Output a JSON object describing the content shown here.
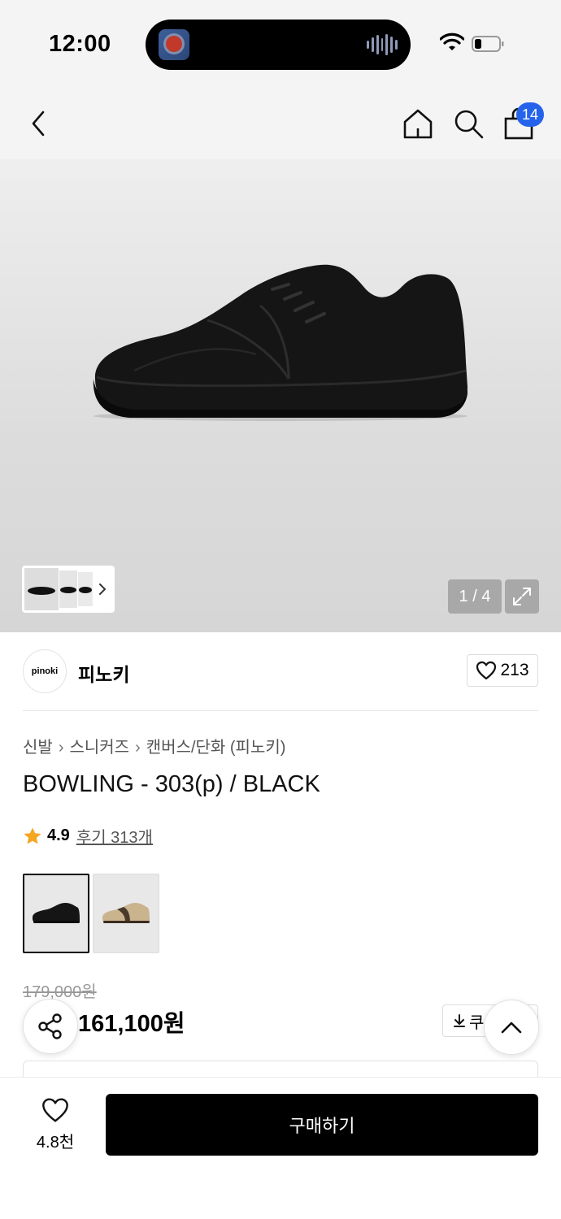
{
  "status_bar": {
    "time": "12:00"
  },
  "nav": {
    "cart_count": "14"
  },
  "gallery": {
    "counter": "1 / 4"
  },
  "brand": {
    "logo_text": "pinoki",
    "name": "피노키",
    "likes": "213"
  },
  "breadcrumb": [
    "신발",
    "스니커즈",
    "캔버스/단화 (피노키)"
  ],
  "product": {
    "title": "BOWLING - 303(p) / BLACK",
    "rating": "4.9",
    "reviews_label": "후기 313개",
    "original_price": "179,000원",
    "sale_price": "161,100원",
    "coupon_label": "쿠"
  },
  "color_options": [
    {
      "name": "black",
      "selected": true
    },
    {
      "name": "beige",
      "selected": false
    }
  ],
  "bottom_bar": {
    "wish_count": "4.8천",
    "buy_label": "구매하기"
  },
  "colors": {
    "accent_blue": "#2563eb",
    "star": "#f5a623",
    "sale_red": "#e02020"
  }
}
